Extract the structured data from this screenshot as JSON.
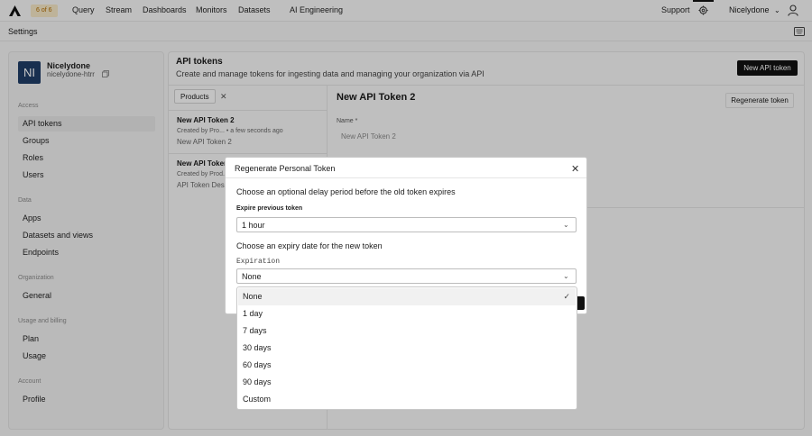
{
  "topbar": {
    "badge": "6 of 6",
    "nav": [
      "Query",
      "Stream",
      "Dashboards",
      "Monitors",
      "Datasets",
      "AI Engineering"
    ],
    "support": "Support",
    "user": "Nicelydone"
  },
  "subbar": {
    "title": "Settings"
  },
  "sidebar": {
    "avatar_initials": "NI",
    "org_name": "Nicelydone",
    "org_slug": "nicelydone-htrr",
    "sections": [
      {
        "label": "Access",
        "items": [
          "API tokens",
          "Groups",
          "Roles",
          "Users"
        ]
      },
      {
        "label": "Data",
        "items": [
          "Apps",
          "Datasets and views",
          "Endpoints"
        ]
      },
      {
        "label": "Organization",
        "items": [
          "General"
        ]
      },
      {
        "label": "Usage and billing",
        "items": [
          "Plan",
          "Usage"
        ]
      },
      {
        "label": "Account",
        "items": [
          "Profile"
        ]
      }
    ]
  },
  "main": {
    "title": "API tokens",
    "description": "Create and manage tokens for ingesting data and managing your organization via API",
    "new_button": "New API token",
    "filter": "Products",
    "list": [
      {
        "title": "New API Token 2",
        "meta": "Created by Pro...  • a few seconds ago",
        "desc": "New API Token 2"
      },
      {
        "title": "New API Token",
        "meta": "Created by Prod...",
        "desc": "API Token Desc"
      }
    ],
    "detail_title": "New API Token 2",
    "regen_button": "Regenerate token",
    "name_label": "Name *",
    "name_value": "New API Token 2"
  },
  "modal": {
    "title": "Regenerate Personal Token",
    "intro": "Choose an optional delay period before the old token expires",
    "expire_label": "Expire previous token",
    "expire_value": "1 hour",
    "expiry_text": "Choose an expiry date for the new token",
    "expiration_label": "Expiration",
    "expiration_value": "None"
  },
  "dropdown": {
    "options": [
      "None",
      "1 day",
      "7 days",
      "30 days",
      "60 days",
      "90 days",
      "Custom"
    ],
    "selected": "None"
  }
}
